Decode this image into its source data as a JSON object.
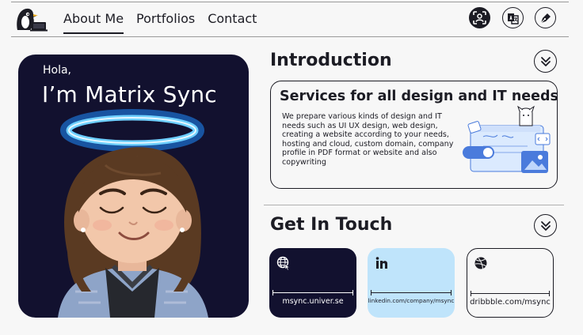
{
  "nav": {
    "items": [
      {
        "label": "About Me",
        "active": true
      },
      {
        "label": "Portfolios",
        "active": false
      },
      {
        "label": "Contact",
        "active": false
      }
    ],
    "actions": [
      {
        "icon": "face-scan-icon"
      },
      {
        "icon": "translate-icon"
      },
      {
        "icon": "pen-nib-icon"
      }
    ]
  },
  "hero": {
    "greeting": "Hola,",
    "name": "I’m Matrix Sync"
  },
  "introduction": {
    "title": "Introduction",
    "services_title": "Services for all design and IT needs",
    "services_description": "We prepare various kinds of design and IT needs such as UI UX design, web design, creating a website according to your needs, hosting and cloud, custom domain, company profile in PDF format or website and also copywriting"
  },
  "touch": {
    "title": "Get In Touch",
    "contacts": [
      {
        "icon": "globe-icon",
        "label": "msync.univer.se"
      },
      {
        "icon": "linkedin-icon",
        "label": "linkedin.com/company/msync"
      },
      {
        "icon": "dribbble-icon",
        "label": "dribbble.com/msync"
      }
    ]
  },
  "colors": {
    "dark": "#12112f",
    "light_blue": "#bfe4fb",
    "halo": "#2aa6ff",
    "background": "#f7f7f7"
  }
}
